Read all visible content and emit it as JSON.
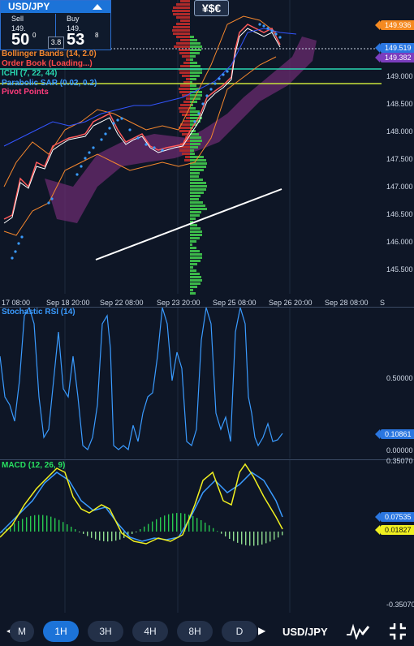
{
  "quote": {
    "symbol": "USD/JPY",
    "sell_label": "Sell",
    "sell_prefix": "149.",
    "sell_big": "50",
    "sell_sup": "0",
    "buy_label": "Buy",
    "buy_prefix": "149.",
    "buy_big": "53",
    "buy_sup": "8",
    "spread": "3.8"
  },
  "currency_button": "¥$€",
  "indicators": [
    {
      "label": "Bollinger Bands (14, 2.0)",
      "color": "#f5872d"
    },
    {
      "label": "Order Book (Loading...)",
      "color": "#ff4a4a"
    },
    {
      "label": "ICHI (7, 22, 44)",
      "color": "#28d7b0"
    },
    {
      "label": "Parabolic SAR (0.02, 0.2)",
      "color": "#3a9bff"
    },
    {
      "label": "Pivot Points",
      "color": "#ff3c7c"
    }
  ],
  "price_axis": [
    "149.000",
    "148.500",
    "148.000",
    "147.500",
    "147.000",
    "146.500",
    "146.000",
    "145.500"
  ],
  "price_tags": [
    {
      "value": "149.936",
      "color": "#f58a21"
    },
    {
      "value": "149.519",
      "color": "#2a76e0"
    },
    {
      "value": "149.382",
      "color": "#7b3dbe"
    }
  ],
  "time_axis": [
    "17 08:00",
    "Sep 18 20:00",
    "Sep 22 08:00",
    "Sep 23 20:00",
    "Sep 25 08:00",
    "Sep 26 20:00",
    "Sep 28 08:00",
    "S"
  ],
  "stoch": {
    "title": "Stochastic RSI (14)",
    "color": "#3a9bff",
    "axis": [
      "0.50000",
      "0.00000"
    ],
    "tag": "0.10861"
  },
  "macd": {
    "title": "MACD (12, 26, 9)",
    "color": "#28e060",
    "axis": [
      "0.35070",
      "-0.35070"
    ],
    "tag_blue": "0.07535",
    "tag_yellow": "0.01827"
  },
  "timeframes": [
    "M",
    "1H",
    "3H",
    "4H",
    "8H",
    "D"
  ],
  "active_timeframe": "1H",
  "bottom_symbol": "USD/JPY"
}
